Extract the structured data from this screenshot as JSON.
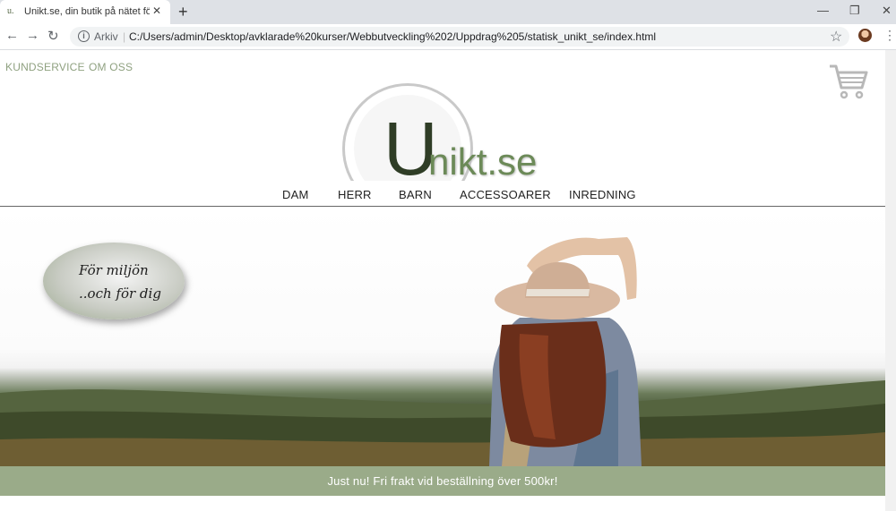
{
  "browser": {
    "tab_title": "Unikt.se, din butik på nätet för m",
    "tab_favicon": "u.",
    "security_label": "Arkiv",
    "url": "C:/Users/admin/Desktop/avklarade%20kurser/Webbutveckling%202/Uppdrag%205/statisk_unikt_se/index.html",
    "icons": [
      "back-icon",
      "forward-icon",
      "reload-icon",
      "info-icon",
      "star-icon",
      "profile-avatar",
      "menu-icon",
      "new-tab-icon",
      "close-icon",
      "minimize-icon",
      "restore-icon"
    ]
  },
  "site": {
    "top_links": [
      "KUNDSERVICE",
      "OM OSS"
    ],
    "logo_first": "U",
    "logo_rest": "nikt.se",
    "nav": [
      "DAM",
      "HERR",
      "BARN",
      "ACCESSOARER",
      "INREDNING"
    ],
    "badge_line1": "För miljön",
    "badge_line2": "..och för dig",
    "promo": "Just nu! Fri frakt vid beställning över 500kr!",
    "colors": {
      "accent": "#9aab89",
      "logo_dark": "#2f3d26",
      "logo_green": "#6c8a58",
      "toplink": "#8fa180"
    }
  }
}
